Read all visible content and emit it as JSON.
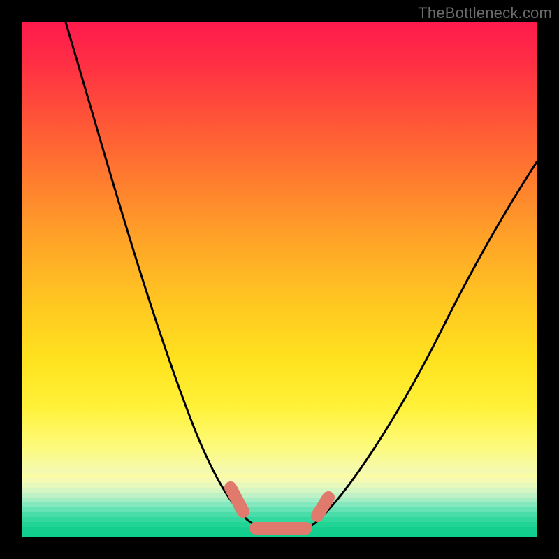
{
  "watermark": "TheBottleneck.com",
  "chart_data": {
    "type": "line",
    "title": "",
    "xlabel": "",
    "ylabel": "",
    "xlim": [
      0,
      100
    ],
    "ylim": [
      0,
      100
    ],
    "grid": false,
    "legend": false,
    "series": [
      {
        "name": "bottleneck-curve",
        "x": [
          10,
          15,
          20,
          25,
          30,
          35,
          38,
          41,
          44,
          47,
          50,
          53,
          56,
          60,
          65,
          70,
          75,
          80,
          85,
          90,
          95,
          100
        ],
        "y": [
          100,
          88,
          76,
          64,
          52,
          38,
          28,
          18,
          10,
          5,
          3,
          3,
          5,
          10,
          20,
          30,
          38,
          46,
          53,
          60,
          66,
          72
        ]
      }
    ],
    "markers": {
      "name": "highlight-sausages",
      "color": "#e07a6c",
      "segments": [
        {
          "x": [
            40,
            42
          ],
          "y": [
            12,
            6
          ]
        },
        {
          "x": [
            44,
            54
          ],
          "y": [
            3,
            3
          ]
        },
        {
          "x": [
            56,
            58
          ],
          "y": [
            5,
            9
          ]
        }
      ]
    },
    "background": {
      "type": "vertical-gradient",
      "stops": [
        {
          "pos": 0,
          "color": "#ff1a4d"
        },
        {
          "pos": 30,
          "color": "#ff7a2f"
        },
        {
          "pos": 55,
          "color": "#ffc821"
        },
        {
          "pos": 83,
          "color": "#fdfb80"
        },
        {
          "pos": 100,
          "color": "#12d18e"
        }
      ]
    }
  }
}
